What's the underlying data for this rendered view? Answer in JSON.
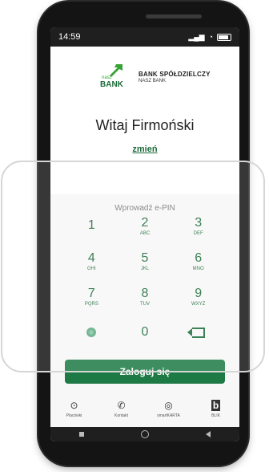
{
  "status": {
    "time": "14:59",
    "signal": "4G"
  },
  "logo": {
    "nasz": "nasz",
    "bank": "BANK",
    "title": "BANK SPÓŁDZIELCZY",
    "subtitle": "NASZ BANK"
  },
  "greeting": {
    "prefix": "Witaj",
    "name": "Firmoński"
  },
  "change_link": "zmień",
  "pin": {
    "prompt": "Wprowadź e-PIN"
  },
  "keypad": {
    "k1": {
      "n": "1",
      "l": ""
    },
    "k2": {
      "n": "2",
      "l": "ABC"
    },
    "k3": {
      "n": "3",
      "l": "DEF"
    },
    "k4": {
      "n": "4",
      "l": "GHI"
    },
    "k5": {
      "n": "5",
      "l": "JKL"
    },
    "k6": {
      "n": "6",
      "l": "MNO"
    },
    "k7": {
      "n": "7",
      "l": "PQRS"
    },
    "k8": {
      "n": "8",
      "l": "TUV"
    },
    "k9": {
      "n": "9",
      "l": "WXYZ"
    },
    "k0": {
      "n": "0",
      "l": ""
    }
  },
  "login_button": "Zaloguj się",
  "nav": [
    {
      "label": "Placówki",
      "icon": "location-icon"
    },
    {
      "label": "Kontakt",
      "icon": "phone-icon"
    },
    {
      "label": "smartKARTA",
      "icon": "card-icon"
    },
    {
      "label": "BLIK",
      "icon": "blik-icon"
    }
  ],
  "colors": {
    "accent": "#1d7a45",
    "brand": "#1c6b3a"
  }
}
